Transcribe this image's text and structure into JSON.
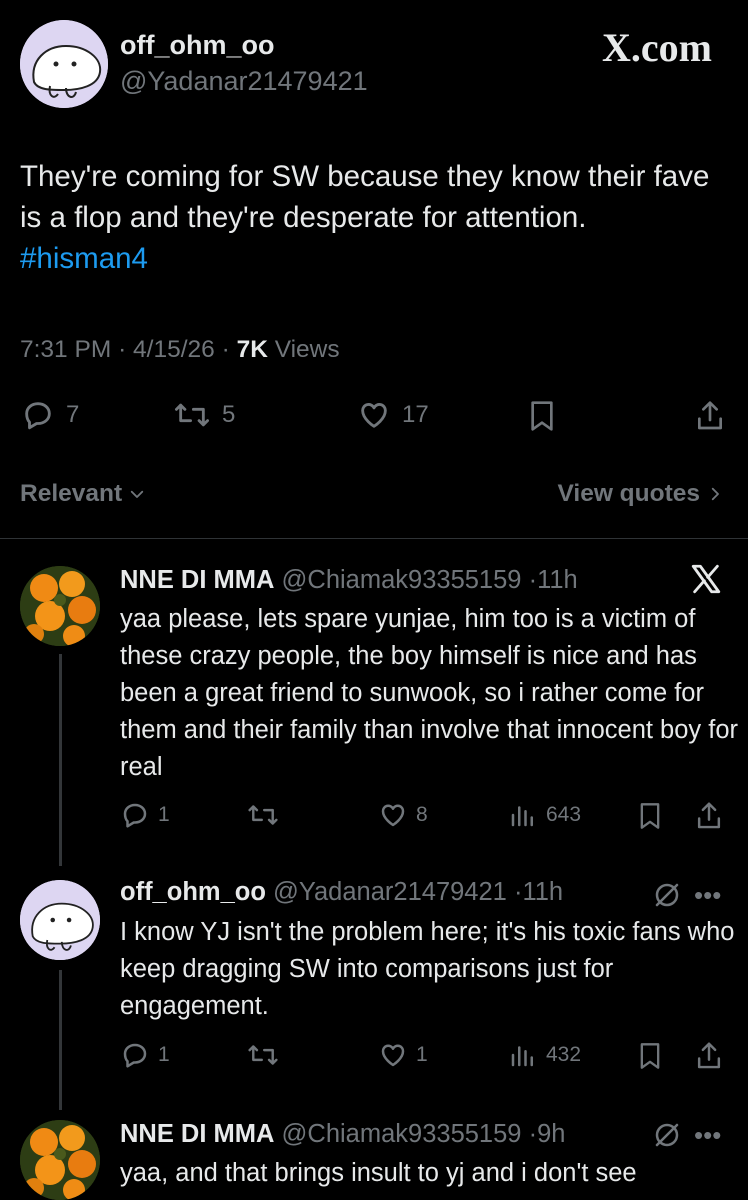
{
  "header": {
    "display_name": "off_ohm_oo",
    "handle": "@Yadanar21479421",
    "brand": "X.com"
  },
  "tweet": {
    "text": "They're coming for SW because they know their fave is a flop and they're desperate for attention.",
    "hashtag": "#hisman4",
    "time": "7:31 PM",
    "date": "4/15/26",
    "views_count": "7K",
    "views_label": "Views",
    "replies": "7",
    "retweets": "5",
    "likes": "17"
  },
  "sort": {
    "relevant_label": "Relevant",
    "view_quotes_label": "View quotes"
  },
  "replies": [
    {
      "name": "NNE DI MMA",
      "handle": "@Chiamak93355159",
      "time": "11h",
      "text": "yaa please, lets spare yunjae, him too is a victim of these crazy people, the boy himself is nice and has been a great friend to sunwook, so i rather come for them and their family than involve that innocent boy for real",
      "replies": "1",
      "retweets": "",
      "likes": "8",
      "views": "643"
    },
    {
      "name": "off_ohm_oo",
      "handle": "@Yadanar21479421",
      "time": "11h",
      "text": "I know YJ isn't the problem here; it's his toxic fans who keep dragging SW into comparisons just for engagement.",
      "replies": "1",
      "retweets": "",
      "likes": "1",
      "views": "432"
    },
    {
      "name": "NNE DI MMA",
      "handle": "@Chiamak93355159",
      "time": "9h",
      "text": "yaa, and that brings insult to yj and i don't see"
    }
  ],
  "colors": {
    "background": "#000000",
    "text": "#e7e9ea",
    "muted": "#71767b",
    "link": "#1d9bf0",
    "divider": "#2f3336"
  }
}
